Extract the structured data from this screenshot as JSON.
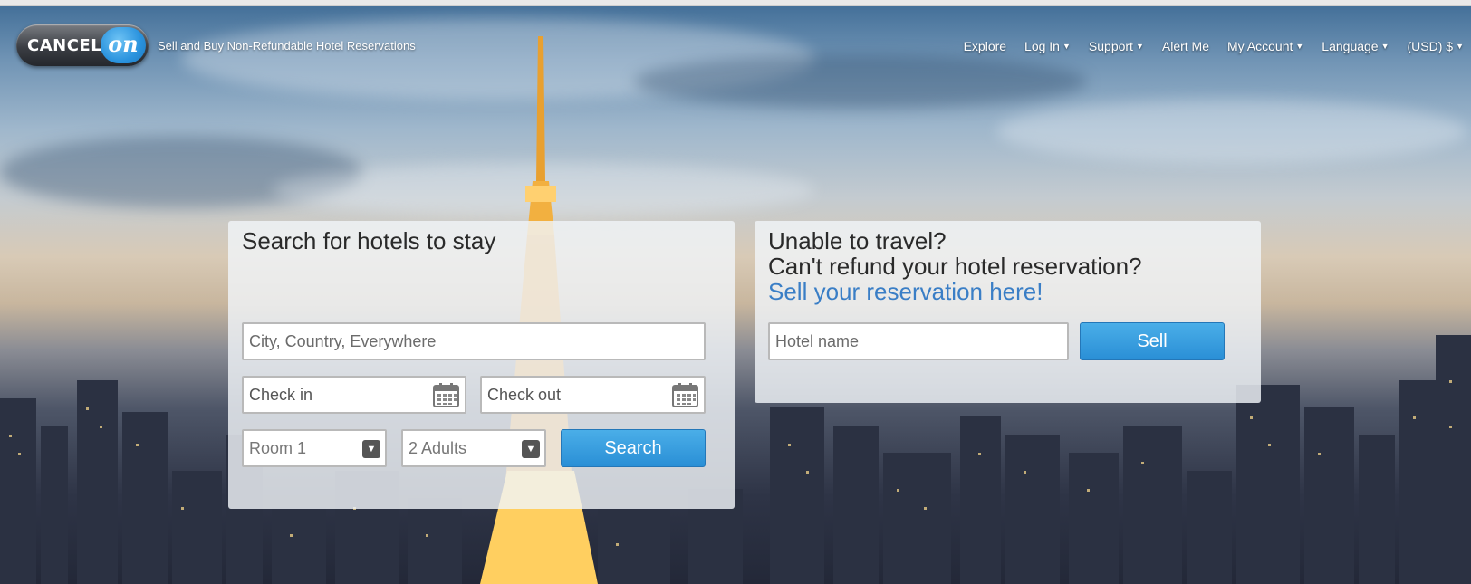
{
  "header": {
    "logo_word": "CANCEL",
    "logo_on": "on",
    "tagline": "Sell and Buy Non-Refundable Hotel Reservations",
    "nav": [
      {
        "label": "Explore",
        "dropdown": false
      },
      {
        "label": "Log In",
        "dropdown": true
      },
      {
        "label": "Support",
        "dropdown": true
      },
      {
        "label": "Alert Me",
        "dropdown": false
      },
      {
        "label": "My Account",
        "dropdown": true
      },
      {
        "label": "Language",
        "dropdown": true
      },
      {
        "label": "(USD) $",
        "dropdown": true
      }
    ]
  },
  "search": {
    "title": "Search for hotels to stay",
    "destination_placeholder": "City, Country, Everywhere",
    "checkin_placeholder": "Check in",
    "checkout_placeholder": "Check out",
    "room_value": "Room 1",
    "adults_value": "2 Adults",
    "search_label": "Search"
  },
  "sell": {
    "line1": "Unable to travel?",
    "line2": "Can't refund your hotel reservation?",
    "line3": "Sell your reservation here!",
    "hotel_placeholder": "Hotel name",
    "sell_label": "Sell"
  },
  "colors": {
    "accent": "#2a8fd6",
    "highlight_text": "#3a7ec6"
  },
  "icons": {
    "calendar": "calendar-icon",
    "dropdown": "chevron-down-icon"
  }
}
